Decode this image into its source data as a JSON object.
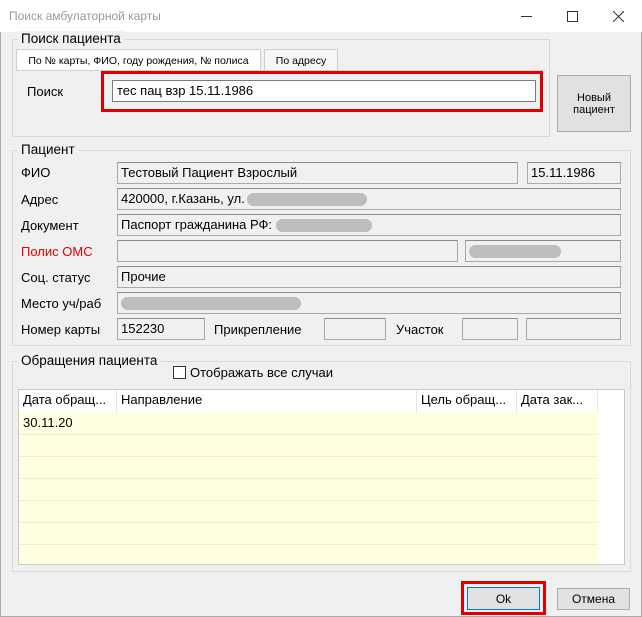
{
  "window": {
    "title": "Поиск амбулаторной карты",
    "minimize_icon": "minimize-icon",
    "maximize_icon": "maximize-icon",
    "close_icon": "close-icon"
  },
  "search": {
    "group_label": "Поиск пациента",
    "tabs": [
      {
        "label": "По № карты, ФИО, году рождения, № полиса"
      },
      {
        "label": "По адресу"
      }
    ],
    "field_label": "Поиск",
    "value": "тес пац взр 15.11.1986",
    "new_patient_button": "Новый пациент"
  },
  "patient": {
    "group_label": "Пациент",
    "fio_label": "ФИО",
    "fio": "Тестовый Пациент Взрослый",
    "birth_date": "15.11.1986",
    "address_label": "Адрес",
    "address": "420000, г.Казань, ул.",
    "document_label": "Документ",
    "document": "Паспорт гражданина РФ:",
    "oms_label": "Полис ОМС",
    "status_label": "Соц. статус",
    "status": "Прочие",
    "work_label": "Место уч/раб",
    "card_label": "Номер карты",
    "card_number": "152230",
    "attach_label": "Прикрепление",
    "area_label": "Участок",
    "colors": {
      "oms_label": "#e00000"
    }
  },
  "visits": {
    "group_label": "Обращения пациента",
    "show_all_label": "Отображать все случаи",
    "columns": [
      "Дата обращ...",
      "Направление",
      "Цель обращ...",
      "Дата зак..."
    ],
    "rows": [
      [
        "30.11.20",
        "",
        "",
        ""
      ]
    ]
  },
  "footer": {
    "ok_label": "Ok",
    "cancel_label": "Отмена"
  }
}
